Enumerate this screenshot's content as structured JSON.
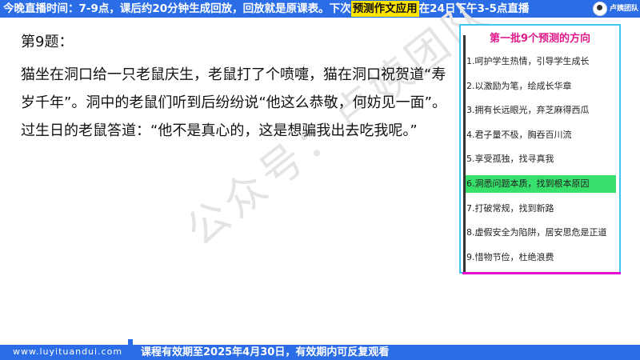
{
  "banner": {
    "text_before": "今晚直播时间：7-9点，课后约20分钟生成回放，回放就是原课表。下次",
    "highlight": "预测作文应用",
    "text_after": "在24日下午3-5点直播",
    "logo_text": "卢姨团队"
  },
  "question": {
    "title": "第9题：",
    "body": "猫坐在洞口给一只老鼠庆生，老鼠打了个喷嚏，猫在洞口祝贺道“寿岁千年”。洞中的老鼠们听到后纷纷说“他这么恭敬，何妨见一面”。过生日的老鼠答道：“他不是真心的，这是想骗我出去吃我呢。”"
  },
  "watermark": "公众号：卢姨团队",
  "panel": {
    "title": "第一批9个预测的方向",
    "items": [
      "1.呵护学生热情，引导学生成长",
      "2.以激励为笔，绘成长华章",
      "3.拥有长远眼光，弃芝麻得西瓜",
      "4.君子量不极，胸吞百川流",
      "5.享受孤独，找寻真我",
      "6.洞悉问题本质，找到根本原因",
      "7.打破常规，找到新路",
      "8.虚假安全为陷阱，居安思危是正道",
      "9.惜物节俭，杜绝浪费"
    ],
    "highlight_index": 5
  },
  "footer": {
    "site": "www.luyituandui.com",
    "notice": "课程有效期至2025年4月30日，有效期内可反复观看"
  },
  "colors": {
    "banner_blue": "#2b6de6",
    "highlight_yellow": "#ffe400",
    "panel_title_pink": "#e0198b",
    "panel_border": "#3cc6f0",
    "item_highlight_green": "#37e06a"
  }
}
